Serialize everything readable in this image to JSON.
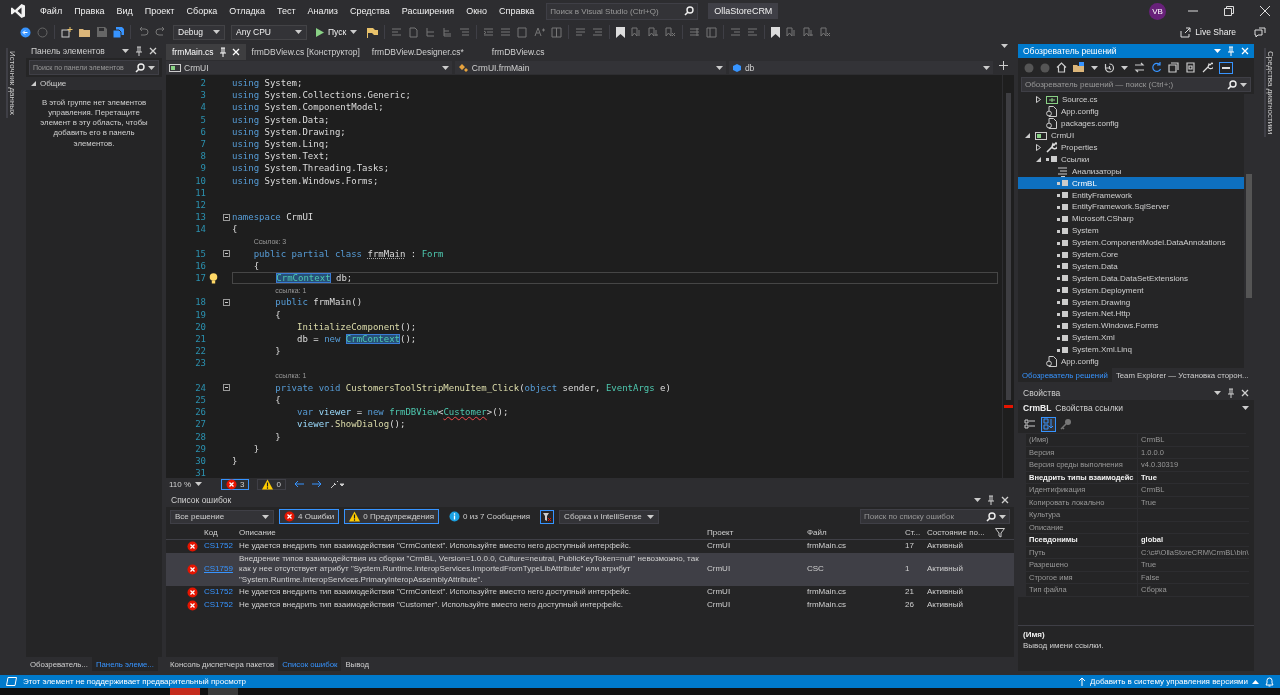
{
  "title_bar": {
    "menu": [
      "Файл",
      "Правка",
      "Вид",
      "Проект",
      "Сборка",
      "Отладка",
      "Тест",
      "Анализ",
      "Средства",
      "Расширения",
      "Окно",
      "Справка"
    ],
    "search": {
      "placeholder": "Поиск в Visual Studio (Ctrl+Q)"
    },
    "solution_name": "OllaStoreCRM",
    "avatar": "VB"
  },
  "toolbar": {
    "configuration": "Debug",
    "platform": "Any CPU",
    "run": "Пуск",
    "live_share": "Live Share"
  },
  "left_side_tabs": [
    "Источник данных"
  ],
  "toolbox": {
    "title": "Панель элементов",
    "search": {
      "placeholder": "Поиск по панели элементов"
    },
    "group": {
      "label": "Общие",
      "expanded": true
    },
    "message": "В этой группе нет элементов управления. Перетащите элемент в эту область, чтобы добавить его в панель элементов.",
    "tabs": [
      {
        "label": "Обозреватель...",
        "selected": false
      },
      {
        "label": "Панель элеме...",
        "selected": true
      }
    ]
  },
  "editor": {
    "tabs": [
      {
        "label": "frmMain.cs",
        "selected": true
      },
      {
        "label": "frmDBView.cs [Конструктор]",
        "selected": false
      },
      {
        "label": "frmDBView.Designer.cs*",
        "selected": false
      },
      {
        "label": "frmDBView.cs",
        "selected": false
      }
    ],
    "navigation": [
      {
        "label": "CrmUI",
        "kind": "project"
      },
      {
        "label": "CrmUI.frmMain",
        "kind": "class"
      },
      {
        "label": "db",
        "kind": "field"
      }
    ],
    "lines": [
      {
        "kind": "code",
        "number": "2",
        "tokens": [
          {
            "text": "using",
            "kind": "keyword"
          },
          {
            "text": " System;",
            "kind": "plain"
          }
        ]
      },
      {
        "kind": "code",
        "number": "3",
        "tokens": [
          {
            "text": "using",
            "kind": "keyword"
          },
          {
            "text": " System.Collections.Generic;",
            "kind": "plain"
          }
        ]
      },
      {
        "kind": "code",
        "number": "4",
        "tokens": [
          {
            "text": "using",
            "kind": "keyword"
          },
          {
            "text": " System.ComponentModel;",
            "kind": "plain"
          }
        ]
      },
      {
        "kind": "code",
        "number": "5",
        "tokens": [
          {
            "text": "using",
            "kind": "keyword"
          },
          {
            "text": " System.Data;",
            "kind": "plain"
          }
        ]
      },
      {
        "kind": "code",
        "number": "6",
        "tokens": [
          {
            "text": "using",
            "kind": "keyword"
          },
          {
            "text": " System.Drawing;",
            "kind": "plain"
          }
        ]
      },
      {
        "kind": "code",
        "number": "7",
        "tokens": [
          {
            "text": "using",
            "kind": "keyword"
          },
          {
            "text": " System.Linq;",
            "kind": "plain"
          }
        ]
      },
      {
        "kind": "code",
        "number": "8",
        "tokens": [
          {
            "text": "using",
            "kind": "keyword"
          },
          {
            "text": " System.Text;",
            "kind": "plain"
          }
        ]
      },
      {
        "kind": "code",
        "number": "9",
        "tokens": [
          {
            "text": "using",
            "kind": "keyword"
          },
          {
            "text": " System.Threading.Tasks;",
            "kind": "plain"
          }
        ]
      },
      {
        "kind": "code",
        "number": "10",
        "tokens": [
          {
            "text": "using",
            "kind": "keyword"
          },
          {
            "text": " System.Windows.Forms;",
            "kind": "plain"
          }
        ]
      },
      {
        "kind": "code",
        "number": "11"
      },
      {
        "kind": "code",
        "number": "12"
      },
      {
        "kind": "code",
        "number": "13",
        "fold": true,
        "tokens": [
          {
            "text": "namespace",
            "kind": "keyword"
          },
          {
            "text": " CrmUI",
            "kind": "plain"
          }
        ]
      },
      {
        "kind": "code",
        "number": "14",
        "tokens": [
          {
            "text": "{",
            "kind": "plain"
          }
        ]
      },
      {
        "kind": "lens",
        "text": "Ссылок: 3"
      },
      {
        "kind": "code",
        "number": "15",
        "fold": true,
        "tokens": [
          {
            "text": "    public partial class ",
            "kind": "keyword"
          },
          {
            "text": "frmMain",
            "kind": "plain",
            "hint_underline": true
          },
          {
            "text": " : ",
            "kind": "plain"
          },
          {
            "text": "Form",
            "kind": "type"
          }
        ]
      },
      {
        "kind": "code",
        "number": "16",
        "tokens": [
          {
            "text": "    {",
            "kind": "plain"
          }
        ]
      },
      {
        "kind": "code",
        "number": "17",
        "current": true,
        "lightbulb": true,
        "tokens": [
          {
            "text": "        CrmContext",
            "kind": "type",
            "highlighted": true
          },
          {
            "text": " db;",
            "kind": "plain"
          }
        ]
      },
      {
        "kind": "lens",
        "text": "ссылка: 1"
      },
      {
        "kind": "code",
        "number": "18",
        "fold": true,
        "tokens": [
          {
            "text": "        public",
            "kind": "keyword"
          },
          {
            "text": " frmMain()",
            "kind": "plain"
          }
        ]
      },
      {
        "kind": "code",
        "number": "19",
        "tokens": [
          {
            "text": "        {",
            "kind": "plain"
          }
        ]
      },
      {
        "kind": "code",
        "number": "20",
        "tokens": [
          {
            "text": "            InitializeComponent",
            "kind": "method"
          },
          {
            "text": "();",
            "kind": "plain"
          }
        ]
      },
      {
        "kind": "code",
        "number": "21",
        "tokens": [
          {
            "text": "            db = ",
            "kind": "plain"
          },
          {
            "text": "new ",
            "kind": "keyword"
          },
          {
            "text": "CrmContext",
            "kind": "type",
            "highlighted": true
          },
          {
            "text": "();",
            "kind": "plain"
          }
        ]
      },
      {
        "kind": "code",
        "number": "22",
        "tokens": [
          {
            "text": "        }",
            "kind": "plain"
          }
        ]
      },
      {
        "kind": "code",
        "number": "23"
      },
      {
        "kind": "lens",
        "text": "ссылка: 1"
      },
      {
        "kind": "code",
        "number": "24",
        "fold": true,
        "tokens": [
          {
            "text": "        private void ",
            "kind": "keyword"
          },
          {
            "text": "CustomersToolStripMenuItem_Click",
            "kind": "method"
          },
          {
            "text": "(",
            "kind": "plain"
          },
          {
            "text": "object",
            "kind": "keyword"
          },
          {
            "text": " sender, ",
            "kind": "plain"
          },
          {
            "text": "EventArgs",
            "kind": "type"
          },
          {
            "text": " e)",
            "kind": "plain"
          }
        ]
      },
      {
        "kind": "code",
        "number": "25",
        "tokens": [
          {
            "text": "        {",
            "kind": "plain"
          }
        ]
      },
      {
        "kind": "code",
        "number": "26",
        "tokens": [
          {
            "text": "            var ",
            "kind": "keyword"
          },
          {
            "text": "viewer",
            "kind": "variable"
          },
          {
            "text": " = ",
            "kind": "plain"
          },
          {
            "text": "new ",
            "kind": "keyword"
          },
          {
            "text": "frmDBView",
            "kind": "type"
          },
          {
            "text": "<",
            "kind": "plain"
          },
          {
            "text": "Customer",
            "kind": "type",
            "error_underline": true
          },
          {
            "text": ">();",
            "kind": "plain"
          }
        ]
      },
      {
        "kind": "code",
        "number": "27",
        "tokens": [
          {
            "text": "            viewer",
            "kind": "variable"
          },
          {
            "text": ".",
            "kind": "plain"
          },
          {
            "text": "ShowDialog",
            "kind": "method"
          },
          {
            "text": "();",
            "kind": "plain"
          }
        ]
      },
      {
        "kind": "code",
        "number": "28",
        "tokens": [
          {
            "text": "        }",
            "kind": "plain"
          }
        ]
      },
      {
        "kind": "code",
        "number": "29",
        "tokens": [
          {
            "text": "    }",
            "kind": "plain"
          }
        ]
      },
      {
        "kind": "code",
        "number": "30",
        "tokens": [
          {
            "text": "}",
            "kind": "plain"
          }
        ]
      },
      {
        "kind": "code",
        "number": "31"
      }
    ],
    "zoom": "110 %",
    "error_count": "3",
    "warning_count": "0"
  },
  "error_list": {
    "title": "Список ошибок",
    "scope": "Все решение",
    "filters": [
      {
        "label": "4 Ошибки",
        "kind": "error",
        "selected": true
      },
      {
        "label": "0 Предупреждения",
        "kind": "warning",
        "selected": true
      },
      {
        "label": "0 из 7 Сообщения",
        "kind": "info",
        "selected": false
      }
    ],
    "source": "Сборка и IntelliSense",
    "search": {
      "placeholder": "Поиск по списку ошибок"
    },
    "columns": [
      "Код",
      "Описание",
      "Проект",
      "Файл",
      "Ст...",
      "Состояние по..."
    ],
    "rows": [
      {
        "kind": "error",
        "code": "CS1752",
        "description": "Не удается внедрить тип взаимодействия \"CrmContext\". Используйте вместо него доступный интерфейс.",
        "project": "CrmUI",
        "file": "frmMain.cs",
        "line": "17",
        "state": "Активный",
        "selected": false
      },
      {
        "kind": "error",
        "code": "CS1759",
        "description": "Внедрение типов взаимодействия из сборки \"CrmBL, Version=1.0.0.0, Culture=neutral, PublicKeyToken=null\" невозможно, так как у нее отсутствует атрибут \"System.Runtime.InteropServices.ImportedFromTypeLibAttribute\" или атрибут \"System.Runtime.InteropServices.PrimaryInteropAssemblyAttribute\".",
        "project": "CrmUI",
        "file": "CSC",
        "line": "1",
        "state": "Активный",
        "selected": true
      },
      {
        "kind": "error",
        "code": "CS1752",
        "description": "Не удается внедрить тип взаимодействия \"CrmContext\". Используйте вместо него доступный интерфейс.",
        "project": "CrmUI",
        "file": "frmMain.cs",
        "line": "21",
        "state": "Активный",
        "selected": false
      },
      {
        "kind": "error",
        "code": "CS1752",
        "description": "Не удается внедрить тип взаимодействия \"Customer\". Используйте вместо него доступный интерфейс.",
        "project": "CrmUI",
        "file": "frmMain.cs",
        "line": "26",
        "state": "Активный",
        "selected": false
      }
    ],
    "tabs": [
      {
        "label": "Консоль диспетчера пакетов",
        "selected": false
      },
      {
        "label": "Список ошибок",
        "selected": true
      },
      {
        "label": "Вывод",
        "selected": false
      }
    ]
  },
  "solution_explorer": {
    "title": "Обозреватель решений",
    "search": {
      "placeholder": "Обозреватель решений — поиск (Ctrl+;)"
    },
    "continued": [
      {
        "label": "Source.cs",
        "kind": "cs-file",
        "expanded": false,
        "selected": false
      },
      {
        "label": "App.config",
        "kind": "config",
        "selected": false
      },
      {
        "label": "packages.config",
        "kind": "config",
        "selected": false
      }
    ],
    "tree": [
      {
        "label": "CrmUI",
        "kind": "project",
        "expanded": true,
        "selected": false,
        "children": [
          {
            "label": "Properties",
            "kind": "properties",
            "expanded": false,
            "selected": false
          },
          {
            "label": "Ссылки",
            "kind": "references",
            "expanded": true,
            "selected": false,
            "children": [
              {
                "label": "Анализаторы",
                "kind": "analyzers",
                "selected": false
              },
              {
                "label": "CrmBL",
                "kind": "reference",
                "selected": true
              },
              {
                "label": "EntityFramework",
                "kind": "reference",
                "selected": false
              },
              {
                "label": "EntityFramework.SqlServer",
                "kind": "reference",
                "selected": false
              },
              {
                "label": "Microsoft.CSharp",
                "kind": "reference",
                "selected": false
              },
              {
                "label": "System",
                "kind": "reference",
                "selected": false
              },
              {
                "label": "System.ComponentModel.DataAnnotations",
                "kind": "reference",
                "selected": false
              },
              {
                "label": "System.Core",
                "kind": "reference",
                "selected": false
              },
              {
                "label": "System.Data",
                "kind": "reference",
                "selected": false
              },
              {
                "label": "System.Data.DataSetExtensions",
                "kind": "reference",
                "selected": false
              },
              {
                "label": "System.Deployment",
                "kind": "reference",
                "selected": false
              },
              {
                "label": "System.Drawing",
                "kind": "reference",
                "selected": false
              },
              {
                "label": "System.Net.Http",
                "kind": "reference",
                "selected": false
              },
              {
                "label": "System.Windows.Forms",
                "kind": "reference",
                "selected": false
              },
              {
                "label": "System.Xml",
                "kind": "reference",
                "selected": false
              },
              {
                "label": "System.Xml.Linq",
                "kind": "reference",
                "selected": false
              }
            ]
          },
          {
            "label": "App.config",
            "kind": "config",
            "selected": false
          }
        ]
      }
    ],
    "tabs": [
      {
        "label": "Обозреватель решений",
        "selected": true
      },
      {
        "label": "Team Explorer — Установка сторон...",
        "selected": false
      }
    ]
  },
  "right_side_tabs": [
    "Средства диагностики"
  ],
  "properties": {
    "title": "Свойства",
    "object": "CrmBL",
    "object_type": "Свойства ссылки",
    "sort_buttons": [
      {
        "kind": "categorized",
        "selected": false
      },
      {
        "kind": "alphabetical",
        "selected": true
      }
    ],
    "rows": [
      {
        "name": "(Имя)",
        "value": "CrmBL",
        "modified": false
      },
      {
        "name": "Версия",
        "value": "1.0.0.0",
        "modified": false
      },
      {
        "name": "Версия среды выполнения",
        "value": "v4.0.30319",
        "modified": false
      },
      {
        "name": "Внедрить типы взаимодейс",
        "value": "True",
        "modified": true
      },
      {
        "name": "Идентификация",
        "value": "CrmBL",
        "modified": false
      },
      {
        "name": "Копировать локально",
        "value": "True",
        "modified": false
      },
      {
        "name": "Культура",
        "modified": false
      },
      {
        "name": "Описание",
        "modified": false
      },
      {
        "name": "Псевдонимы",
        "value": "global",
        "modified": true
      },
      {
        "name": "Путь",
        "value": "C:\\c#\\OllaStoreCRM\\CrmBL\\bin\\",
        "modified": false
      },
      {
        "name": "Разрешено",
        "value": "True",
        "modified": false
      },
      {
        "name": "Строгое имя",
        "value": "False",
        "modified": false
      },
      {
        "name": "Тип файла",
        "value": "Сборка",
        "modified": false
      }
    ],
    "description_title": "(Имя)",
    "description": "Вывод имени ссылки."
  },
  "status_bar": {
    "message": "Этот элемент не поддерживает предварительный просмотр",
    "source_control": "Добавить в систему управления версиями"
  }
}
